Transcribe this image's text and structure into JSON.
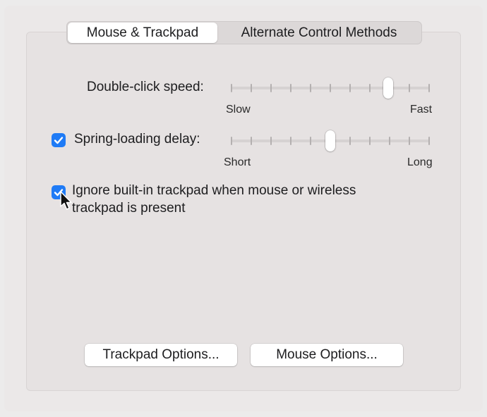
{
  "tabs": {
    "active": "Mouse & Trackpad",
    "inactive": "Alternate Control Methods"
  },
  "double_click": {
    "label": "Double-click speed:",
    "min_label": "Slow",
    "max_label": "Fast",
    "value": 0.79,
    "ticks": 11
  },
  "spring_loading": {
    "checked": true,
    "label": "Spring-loading delay:",
    "min_label": "Short",
    "max_label": "Long",
    "value": 0.5,
    "ticks": 11
  },
  "ignore_trackpad": {
    "checked": true,
    "label_line1": "Ignore built-in trackpad when mouse or wireless",
    "label_line2": "trackpad is present"
  },
  "buttons": {
    "trackpad_options": "Trackpad Options...",
    "mouse_options": "Mouse Options..."
  },
  "colors": {
    "accent": "#1f7bf6"
  }
}
